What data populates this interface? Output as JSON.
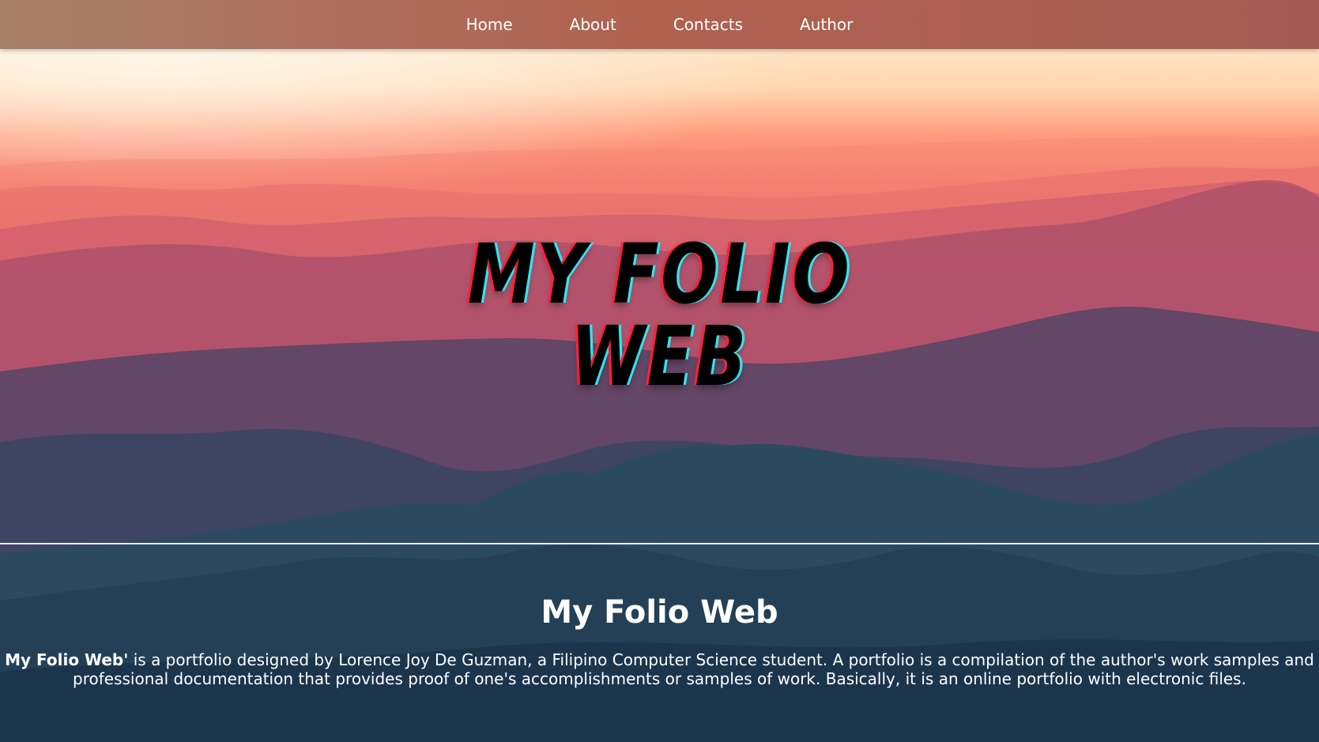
{
  "nav": {
    "items": [
      "Home",
      "About",
      "Contacts",
      "Author"
    ]
  },
  "hero": {
    "line1": "MY FOLIO",
    "line2": "WEB"
  },
  "about": {
    "title": "My Folio Web",
    "text_bold": "My Folio Web'",
    "text_rest": " is a portfolio designed by Lorence Joy De Guzman, a Filipino Computer Science student. A portfolio is a compilation of the author's work samples and professional documentation that provides proof of one's accomplishments or samples of work. Basically, it is an online portfolio with electronic files."
  },
  "colors": {
    "nav_bg": "#ab6655",
    "title_red_shadow": "#ff1f3d",
    "title_cyan_shadow": "#2ee6f0"
  }
}
